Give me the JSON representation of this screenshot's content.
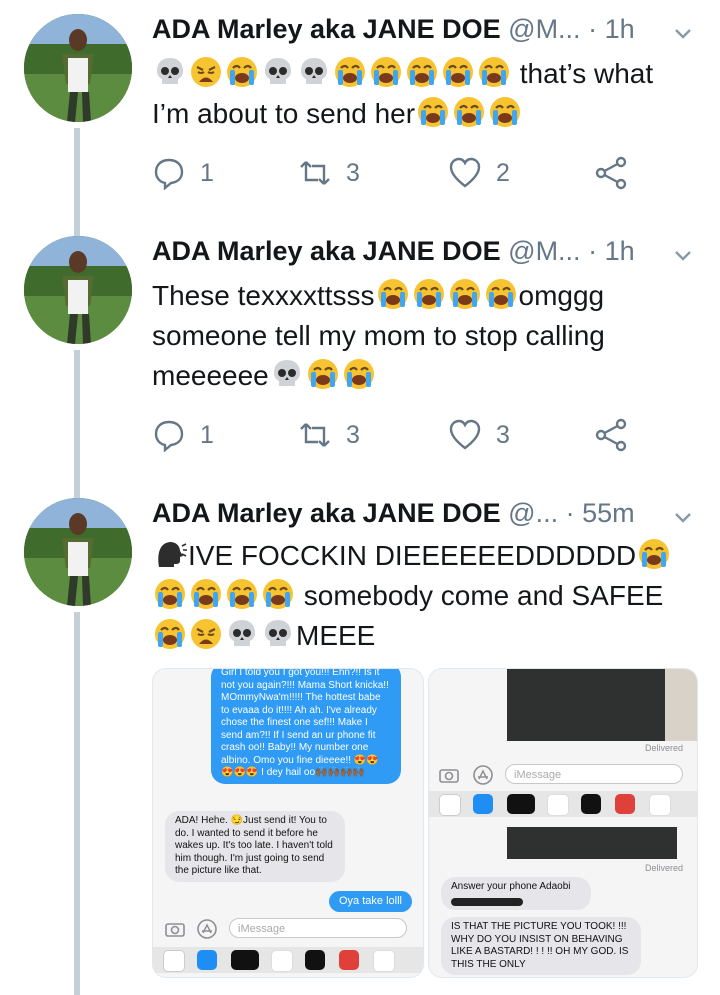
{
  "colors": {
    "accent": "#2f9bf4",
    "muted": "#657786",
    "thread": "#c4cfd6"
  },
  "tweets": [
    {
      "name": "ADA Marley aka JANE DOE",
      "handle": "@M...",
      "sep": "·",
      "time": "1h",
      "text_a": "that’s what",
      "text_b": "I’m about to send her",
      "reply_count": "1",
      "retweet_count": "3",
      "like_count": "2"
    },
    {
      "name": "ADA Marley aka JANE DOE",
      "handle": "@M...",
      "sep": "·",
      "time": "1h",
      "text_a": "These texxxxttsss",
      "text_b": "omggg",
      "text_c": "someone tell my mom to stop calling",
      "text_d": "meeeeee",
      "reply_count": "1",
      "retweet_count": "3",
      "like_count": "3"
    },
    {
      "name": "ADA Marley aka JANE DOE",
      "handle": "@...",
      "sep": "·",
      "time": "55m",
      "text_a": "IVE FOCCKIN DIEEEEEEDDDDDD",
      "text_b": "somebody come and SAFEE",
      "text_c": "MEEE"
    }
  ],
  "shot_left": {
    "blue_msg": "Girl I told you I got you!!! Ehn?!! Is it not you again?!!! Mama Short knicka!! MOmmyNwa'm!!!!! The hottest babe to evaaa do it!!!! Ah ah. I've already chose the finest one sef!!! Make I send am?!! If I send an ur phone fit crash oo!! Baby!! My number one albino. Omo you fine dieeee!! 😍😍😍😍😍 I dey hail oo🙌🏾🙌🏾🙌🏾🙌🏾",
    "gray_msg": "ADA! Hehe. 😏Just send it! You to do. I wanted to send it before he wakes up. It's too late. I haven't told him though. I'm just going to send the picture like that.",
    "blue_short": "Oya take lolll",
    "imessage": "iMessage"
  },
  "shot_right": {
    "delivered_1": "Delivered",
    "imessage": "iMessage",
    "delivered_2": "Delivered",
    "answer_msg": "Answer your phone Adaobi",
    "caps_msg": "IS THAT THE PICTURE YOU TOOK! !!! WHY DO YOU INSIST ON BEHAVING LIKE A BASTARD! ! ! !! OH MY GOD. IS THIS THE ONLY"
  },
  "icons": [
    "reply-icon",
    "retweet-icon",
    "like-icon",
    "share-icon",
    "chevron-down-icon",
    "skull-emoji",
    "crying-emoji",
    "weary-emoji",
    "speaking-head-emoji"
  ]
}
